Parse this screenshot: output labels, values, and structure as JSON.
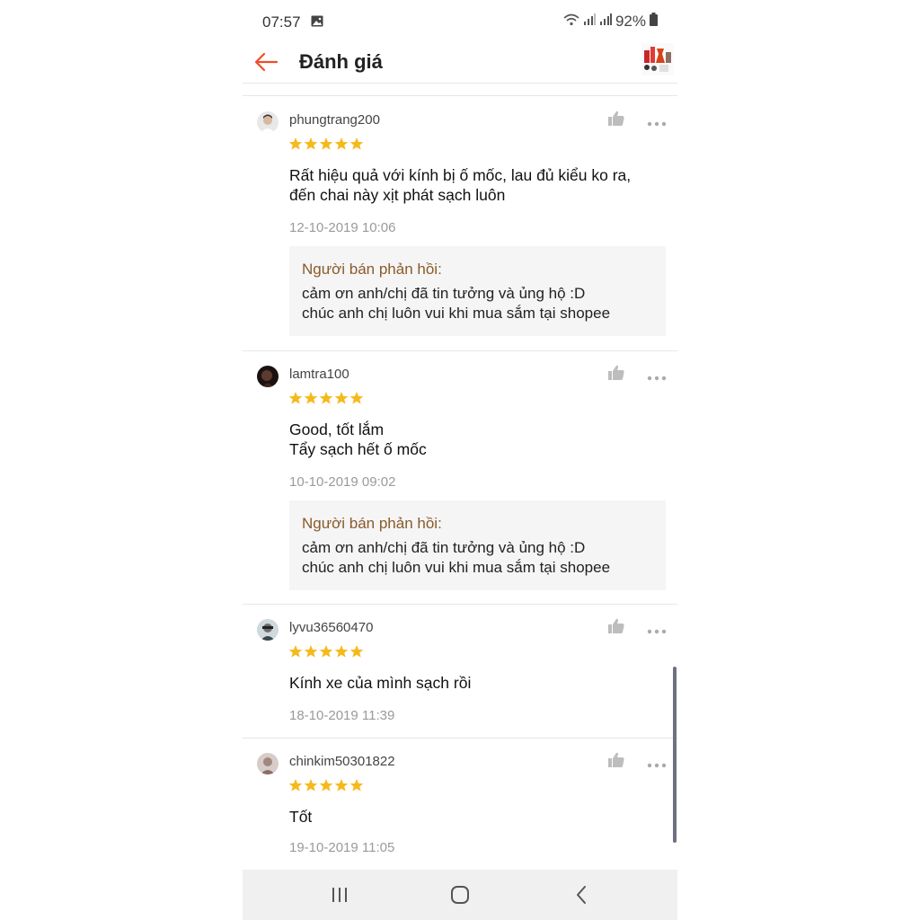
{
  "status_bar": {
    "time": "07:57",
    "battery": "92%",
    "icons": [
      "image-icon",
      "wifi-icon",
      "signal-icon",
      "signal-icon",
      "battery-icon"
    ]
  },
  "header": {
    "title": "Đánh giá",
    "back_icon": "arrow-left-icon",
    "accent_color": "#ee4d2d"
  },
  "reviews": [
    {
      "username": "phungtrang200",
      "rating": 5,
      "text": "Rất hiệu quả với kính bị ố mốc, lau đủ kiểu ko ra,\nđến chai này xịt phát sạch luôn",
      "date": "12-10-2019 10:06",
      "seller_reply": {
        "title": "Người bán phản hồi:",
        "text": "cảm ơn anh/chị đã tin tưởng và ủng hộ :D\nchúc anh chị luôn vui khi mua sắm tại shopee"
      }
    },
    {
      "username": "lamtra100",
      "rating": 5,
      "text": "Good, tốt lắm\nTẩy sạch hết ố mốc",
      "date": "10-10-2019 09:02",
      "seller_reply": {
        "title": "Người bán phản hồi:",
        "text": "cảm ơn anh/chị đã tin tưởng và ủng hộ :D\nchúc anh chị luôn vui khi mua sắm tại shopee"
      }
    },
    {
      "username": "lyvu36560470",
      "rating": 5,
      "text": "Kính xe của mình sạch rồi",
      "date": "18-10-2019 11:39"
    },
    {
      "username": "chinkim50301822",
      "rating": 5,
      "text": "Tốt",
      "date": "19-10-2019 11:05"
    }
  ],
  "colors": {
    "star": "#f5b91b",
    "reply_title": "#8a5a2b",
    "date": "#9a9a9a"
  },
  "nav_bar": {
    "icons": [
      "recent-apps-icon",
      "home-icon",
      "back-icon"
    ]
  }
}
